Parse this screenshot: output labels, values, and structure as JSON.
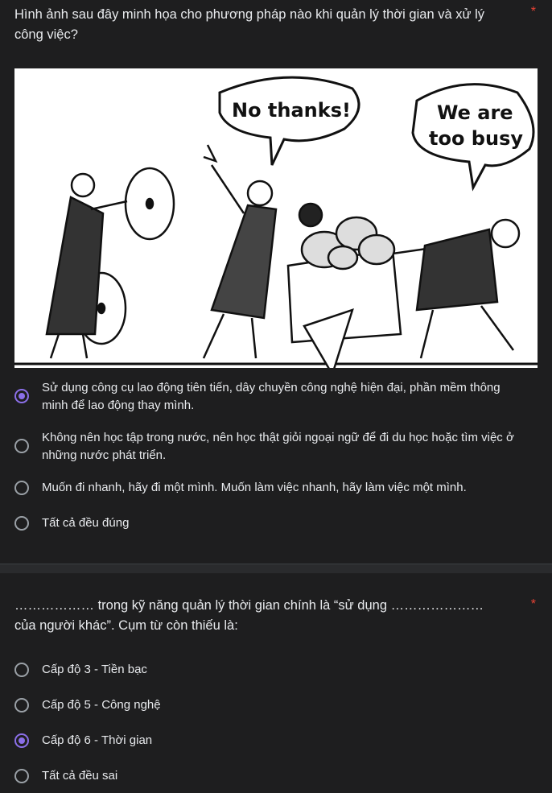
{
  "question1": {
    "text": "Hình ảnh sau đây minh họa cho phương pháp nào khi quản lý thời gian và xử lý công việc?",
    "required_mark": "*",
    "image": {
      "bubble_left": "No thanks!",
      "bubble_right_line1": "We are",
      "bubble_right_line2": "too busy"
    },
    "options": [
      {
        "label": "Sử dụng công cụ lao động tiên tiến, dây chuyền công nghệ hiện đại, phần mềm thông minh để lao động thay mình.",
        "selected": true
      },
      {
        "label": "Không nên học tập trong nước, nên học thật giỏi ngoại ngữ để đi du học hoặc tìm việc ở những nước phát triển.",
        "selected": false
      },
      {
        "label": "Muốn đi nhanh, hãy đi một mình. Muốn làm việc nhanh, hãy làm việc một mình.",
        "selected": false
      },
      {
        "label": "Tất cả đều đúng",
        "selected": false
      }
    ]
  },
  "question2": {
    "text": "……………… trong kỹ năng quản lý thời gian chính là “sử dụng ………………… của người khác”.  Cụm từ còn thiếu là:",
    "required_mark": "*",
    "options": [
      {
        "label": "Cấp độ 3 - Tiền bạc",
        "selected": false
      },
      {
        "label": "Cấp độ 5 - Công nghệ",
        "selected": false
      },
      {
        "label": "Cấp độ 6 - Thời gian",
        "selected": true
      },
      {
        "label": "Tất cả đều sai",
        "selected": false
      }
    ]
  },
  "colors": {
    "background": "#1e1e1f",
    "accent": "#8b6fe8",
    "required": "#ea4335"
  }
}
